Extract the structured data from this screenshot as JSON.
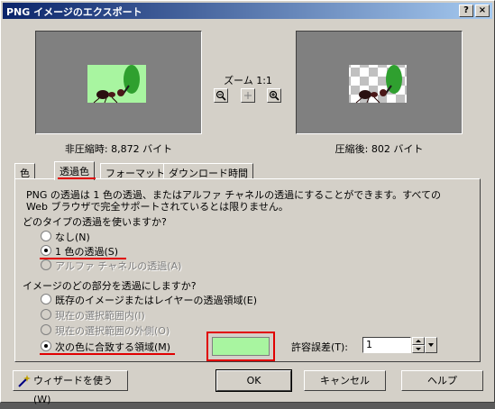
{
  "window": {
    "title": "PNG イメージのエクスポート"
  },
  "titlebar_buttons": {
    "help": "?",
    "close": "×"
  },
  "preview": {
    "original_caption": "非圧縮時: 8,872 バイト",
    "compressed_caption": "圧縮後: 802 バイト",
    "zoom_label": "ズーム 1:1"
  },
  "tabs": [
    {
      "label": "色"
    },
    {
      "label": "透過色"
    },
    {
      "label": "フォーマット"
    },
    {
      "label": "ダウンロード時間"
    }
  ],
  "panel": {
    "description_line1": "PNG の透過は 1 色の透過、またはアルファ チャネルの透過にすることができます。すべての",
    "description_line2": "Web ブラウザで完全サポートされているとは限りません。",
    "type_question": "どのタイプの透過を使いますか?",
    "type_options": [
      {
        "label": "なし(N)",
        "selected": false,
        "enabled": true
      },
      {
        "label": "1 色の透過(S)",
        "selected": true,
        "enabled": true
      },
      {
        "label": "アルファ チャネルの透過(A)",
        "selected": false,
        "enabled": false
      }
    ],
    "area_question": "イメージのどの部分を透過にしますか?",
    "area_options": [
      {
        "label": "既存のイメージまたはレイヤーの透過領域(E)",
        "selected": false,
        "enabled": true
      },
      {
        "label": "現在の選択範囲内(I)",
        "selected": false,
        "enabled": false
      },
      {
        "label": "現在の選択範囲の外側(O)",
        "selected": false,
        "enabled": false
      },
      {
        "label": "次の色に合致する領域(M)",
        "selected": true,
        "enabled": true
      }
    ],
    "tolerance_label": "許容誤差(T):",
    "tolerance_value": "1",
    "match_color": "#a8f5a0"
  },
  "buttons": {
    "wizard": "ウィザードを使う(W)",
    "ok": "OK",
    "cancel": "キャンセル",
    "help": "ヘルプ"
  },
  "colors": {
    "title_start": "#0a246a",
    "title_end": "#a6caf0",
    "highlight": "#e00000"
  }
}
